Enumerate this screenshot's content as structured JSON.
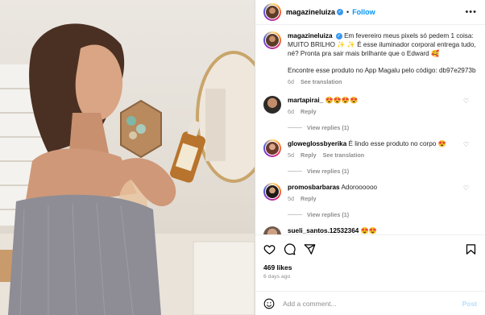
{
  "post": {
    "author": "magazineluiza",
    "follow_label": "Follow",
    "separator": "•",
    "more_label": "•••"
  },
  "caption": {
    "author": "magazineluiza",
    "text": "Em fevereiro meus pixels só pedem 1 coisa: MUITO BRILHO ✨ ✨ É esse iluminador corporal entrega tudo, né? Pronta pra sair mais brilhante que o Edward 🥰",
    "text2": "Encontre esse produto no App Magalu pelo código: db97e2973b",
    "time": "6d",
    "see_translation": "See translation"
  },
  "comments": [
    {
      "user": "martapirai_",
      "text": "😍😍😍😍",
      "time": "6d",
      "reply": "Reply",
      "view_replies": "View replies (1)"
    },
    {
      "user": "gloweglossbyerika",
      "text": "É lindo esse produto no corpo 😍",
      "time": "5d",
      "reply": "Reply",
      "see_translation": "See translation",
      "view_replies": "View replies (1)"
    },
    {
      "user": "promosbarbaras",
      "text": "Adoroooooo",
      "time": "5d",
      "reply": "Reply",
      "view_replies": "View replies (1)"
    },
    {
      "user": "sueli_santos.12532364",
      "text": "😍😍",
      "time": "",
      "reply": ""
    }
  ],
  "actions": {
    "likes": "469 likes",
    "ago": "6 days ago"
  },
  "composer": {
    "placeholder": "Add a comment...",
    "post_label": "Post"
  },
  "colors": {
    "accent": "#0095f6",
    "verified": "#3897f0"
  },
  "icons": [
    "heart-icon",
    "comment-icon",
    "share-icon",
    "bookmark-icon",
    "emoji-icon",
    "verified-icon"
  ]
}
